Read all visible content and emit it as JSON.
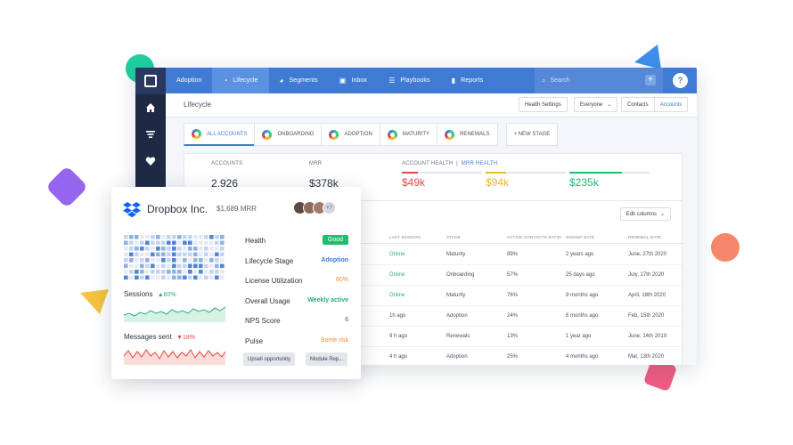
{
  "nav": {
    "items": [
      {
        "label": "Adoption",
        "icon": "adoption"
      },
      {
        "label": "Lifecycle",
        "icon": "lifecycle-icon"
      },
      {
        "label": "Segments",
        "icon": "segments-icon"
      },
      {
        "label": "Inbox",
        "icon": "inbox-icon"
      },
      {
        "label": "Playbooks",
        "icon": "playbooks-icon"
      },
      {
        "label": "Reports",
        "icon": "reports-icon"
      }
    ],
    "search_placeholder": "Search",
    "help": "?"
  },
  "subbar": {
    "title": "Lifecycle",
    "health_settings": "Health Settings",
    "everyone": "Everyone",
    "contacts": "Contacts",
    "accounts": "Accounts"
  },
  "stages": {
    "tabs": [
      "ALL ACCOUNTS",
      "ONBOARDING",
      "ADOPTION",
      "MATURITY",
      "RENEWALS"
    ],
    "new_stage": "+ NEW STAGE"
  },
  "metrics": {
    "accounts_label": "ACCOUNTS",
    "accounts_value": "2,926",
    "mrr_label": "MRR",
    "mrr_value": "$378k",
    "health_label": "ACCOUNT HEALTH",
    "health_sep": "|",
    "health_link": "MRR HEALTH",
    "health_values": [
      {
        "value": "$49k",
        "color": "#e8463f",
        "fill": 0.2
      },
      {
        "value": "$94k",
        "color": "#f0b72f",
        "fill": 0.25
      },
      {
        "value": "$235k",
        "color": "#1fbd6e",
        "fill": 0.65
      }
    ]
  },
  "table": {
    "edit_columns": "Edit columns",
    "headers": [
      "LAST SESSION",
      "STAGE",
      "ACTIVE CONTACTS RATIO",
      "SIGNUP DATE",
      "RENEWAL DATE"
    ],
    "rows": [
      {
        "last_session": "Online",
        "stage": "Maturity",
        "ratio": "89%",
        "signup": "2 years ago",
        "renewal": "June, 27th 2020"
      },
      {
        "last_session": "Online",
        "stage": "Onboarding",
        "ratio": "57%",
        "signup": "25 days ago",
        "renewal": "July, 17th 2020"
      },
      {
        "last_session": "Online",
        "stage": "Maturity",
        "ratio": "76%",
        "signup": "9 months ago",
        "renewal": "April, 18th 2020"
      },
      {
        "last_session": "1h ago",
        "stage": "Adoption",
        "ratio": "24%",
        "signup": "6 months ago",
        "renewal": "Feb, 15th 2020"
      },
      {
        "last_session": "9 h ago",
        "stage": "Renewals",
        "ratio": "13%",
        "signup": "1 year ago",
        "renewal": "June, 14th 2019"
      },
      {
        "last_session": "4 h ago",
        "stage": "Adoption",
        "ratio": "25%",
        "signup": "4 months ago",
        "renewal": "Mar, 13th 2020"
      }
    ]
  },
  "card": {
    "company": "Dropbox Inc.",
    "mrr": "$1,689 MRR",
    "avatars_more": "+7",
    "sessions_label": "Sessions",
    "sessions_change": "▲60%",
    "messages_label": "Messages sent",
    "messages_change": "▼18%",
    "properties": [
      {
        "key": "Health",
        "value": "Good"
      },
      {
        "key": "Lifecycle Stage",
        "value": "Adoption"
      },
      {
        "key": "License Utilization",
        "value": "60%"
      },
      {
        "key": "Overall Usage",
        "value": "Weekly active"
      },
      {
        "key": "NPS Score",
        "value": "6"
      },
      {
        "key": "Pulse",
        "value": "Some risk"
      }
    ],
    "tags": [
      "Upsell opportunity",
      "Module Rep..."
    ]
  },
  "colors": {
    "primary": "#3f7bd3",
    "sidebar": "#1e2a44",
    "good": "#1fbd6e",
    "risk": "#f08a2f",
    "danger": "#e8463f"
  }
}
